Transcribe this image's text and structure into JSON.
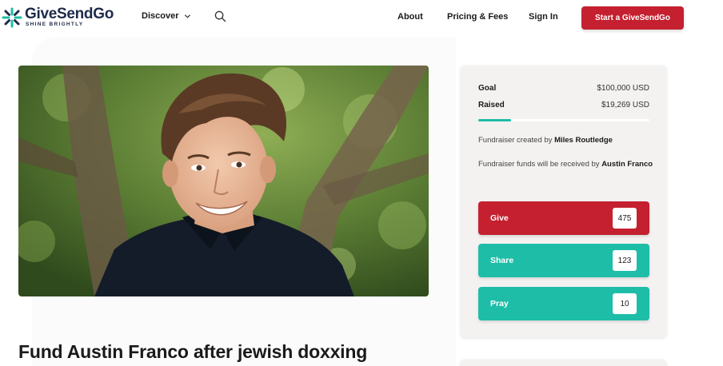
{
  "header": {
    "logo_name": "GiveSendGo",
    "logo_tagline": "SHINE BRIGHTLY",
    "discover_label": "Discover",
    "nav": [
      "About",
      "Pricing & Fees",
      "Sign In"
    ],
    "cta_label": "Start a GiveSendGo"
  },
  "hero": {
    "alt": "Photo of a smiling young man with brown hair in front of trees"
  },
  "campaign": {
    "title": "Fund Austin Franco after jewish doxxing"
  },
  "sidebar": {
    "goal_label": "Goal",
    "goal_value": "$100,000 USD",
    "raised_label": "Raised",
    "raised_value": "$19,269 USD",
    "progress_fraction": 0.19269,
    "created_prefix": "Fundraiser created by",
    "creator": "Miles Routledge",
    "receiver_prefix": "Fundraiser funds will be received by",
    "receiver": "Austin Franco",
    "actions": [
      {
        "label": "Give",
        "count": "475",
        "color": "#c4202f"
      },
      {
        "label": "Share",
        "count": "123",
        "color": "#1ebda8"
      },
      {
        "label": "Pray",
        "count": "10",
        "color": "#1ebda8"
      }
    ]
  },
  "icons": {
    "logo": "sparkle-logo-icon",
    "discover": "chevron-down-icon",
    "search": "search-icon"
  }
}
